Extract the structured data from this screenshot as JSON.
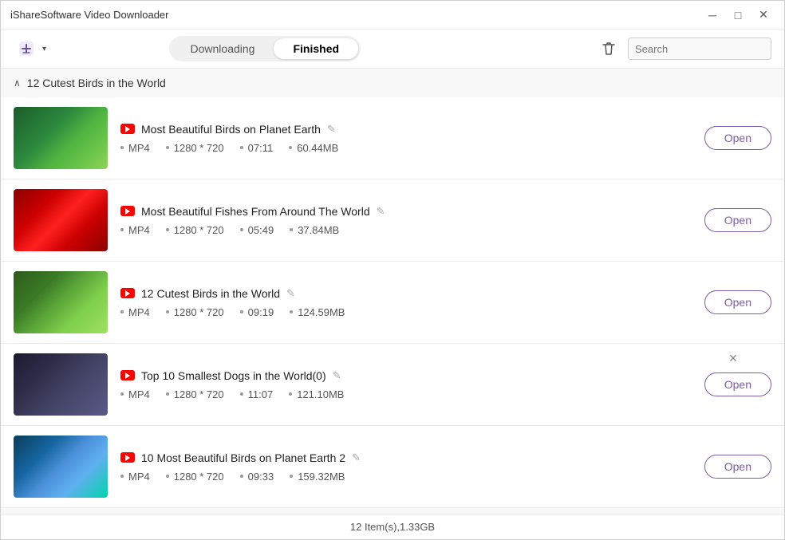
{
  "app": {
    "title": "iShareSoftware Video Downloader"
  },
  "titlebar": {
    "minimize_label": "─",
    "maximize_label": "□",
    "close_label": "✕"
  },
  "toolbar": {
    "add_icon": "⬇",
    "dropdown_arrow": "▾",
    "tab_downloading": "Downloading",
    "tab_finished": "Finished",
    "delete_icon": "🗑",
    "search_placeholder": "Search"
  },
  "group": {
    "title": "12 Cutest Birds in the World",
    "chevron": "∧"
  },
  "videos": [
    {
      "id": 1,
      "title": "Most Beautiful Birds on Planet Earth",
      "format": "MP4",
      "resolution": "1280 * 720",
      "duration": "07:11",
      "size": "60.44MB",
      "thumb_class": "thumb-1",
      "open_label": "Open"
    },
    {
      "id": 2,
      "title": "Most Beautiful Fishes From Around The World",
      "format": "MP4",
      "resolution": "1280 * 720",
      "duration": "05:49",
      "size": "37.84MB",
      "thumb_class": "thumb-2",
      "open_label": "Open"
    },
    {
      "id": 3,
      "title": "12 Cutest Birds in the World",
      "format": "MP4",
      "resolution": "1280 * 720",
      "duration": "09:19",
      "size": "124.59MB",
      "thumb_class": "thumb-3",
      "open_label": "Open"
    },
    {
      "id": 4,
      "title": "Top 10 Smallest Dogs in the World(0)",
      "format": "MP4",
      "resolution": "1280 * 720",
      "duration": "11:07",
      "size": "121.10MB",
      "thumb_class": "thumb-4",
      "open_label": "Open",
      "show_close": true
    },
    {
      "id": 5,
      "title": "10 Most Beautiful Birds on Planet Earth 2",
      "format": "MP4",
      "resolution": "1280 * 720",
      "duration": "09:33",
      "size": "159.32MB",
      "thumb_class": "thumb-5",
      "open_label": "Open"
    }
  ],
  "statusbar": {
    "text": "12 Item(s),1.33GB"
  }
}
